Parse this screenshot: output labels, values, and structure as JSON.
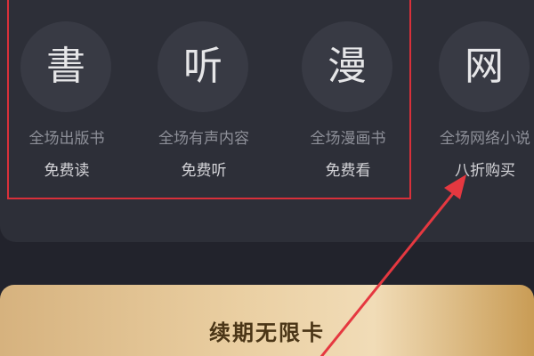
{
  "benefits": [
    {
      "glyph": "書",
      "title": "全场出版书",
      "subtitle": "免费读"
    },
    {
      "glyph": "听",
      "title": "全场有声内容",
      "subtitle": "免费听"
    },
    {
      "glyph": "漫",
      "title": "全场漫画书",
      "subtitle": "免费看"
    },
    {
      "glyph": "网",
      "title": "全场网络小说",
      "subtitle": "八折购买"
    }
  ],
  "renew_card": {
    "title": "续期无限卡"
  },
  "annotation": {
    "box_color": "#d8303a",
    "arrow_color": "#e53840"
  }
}
